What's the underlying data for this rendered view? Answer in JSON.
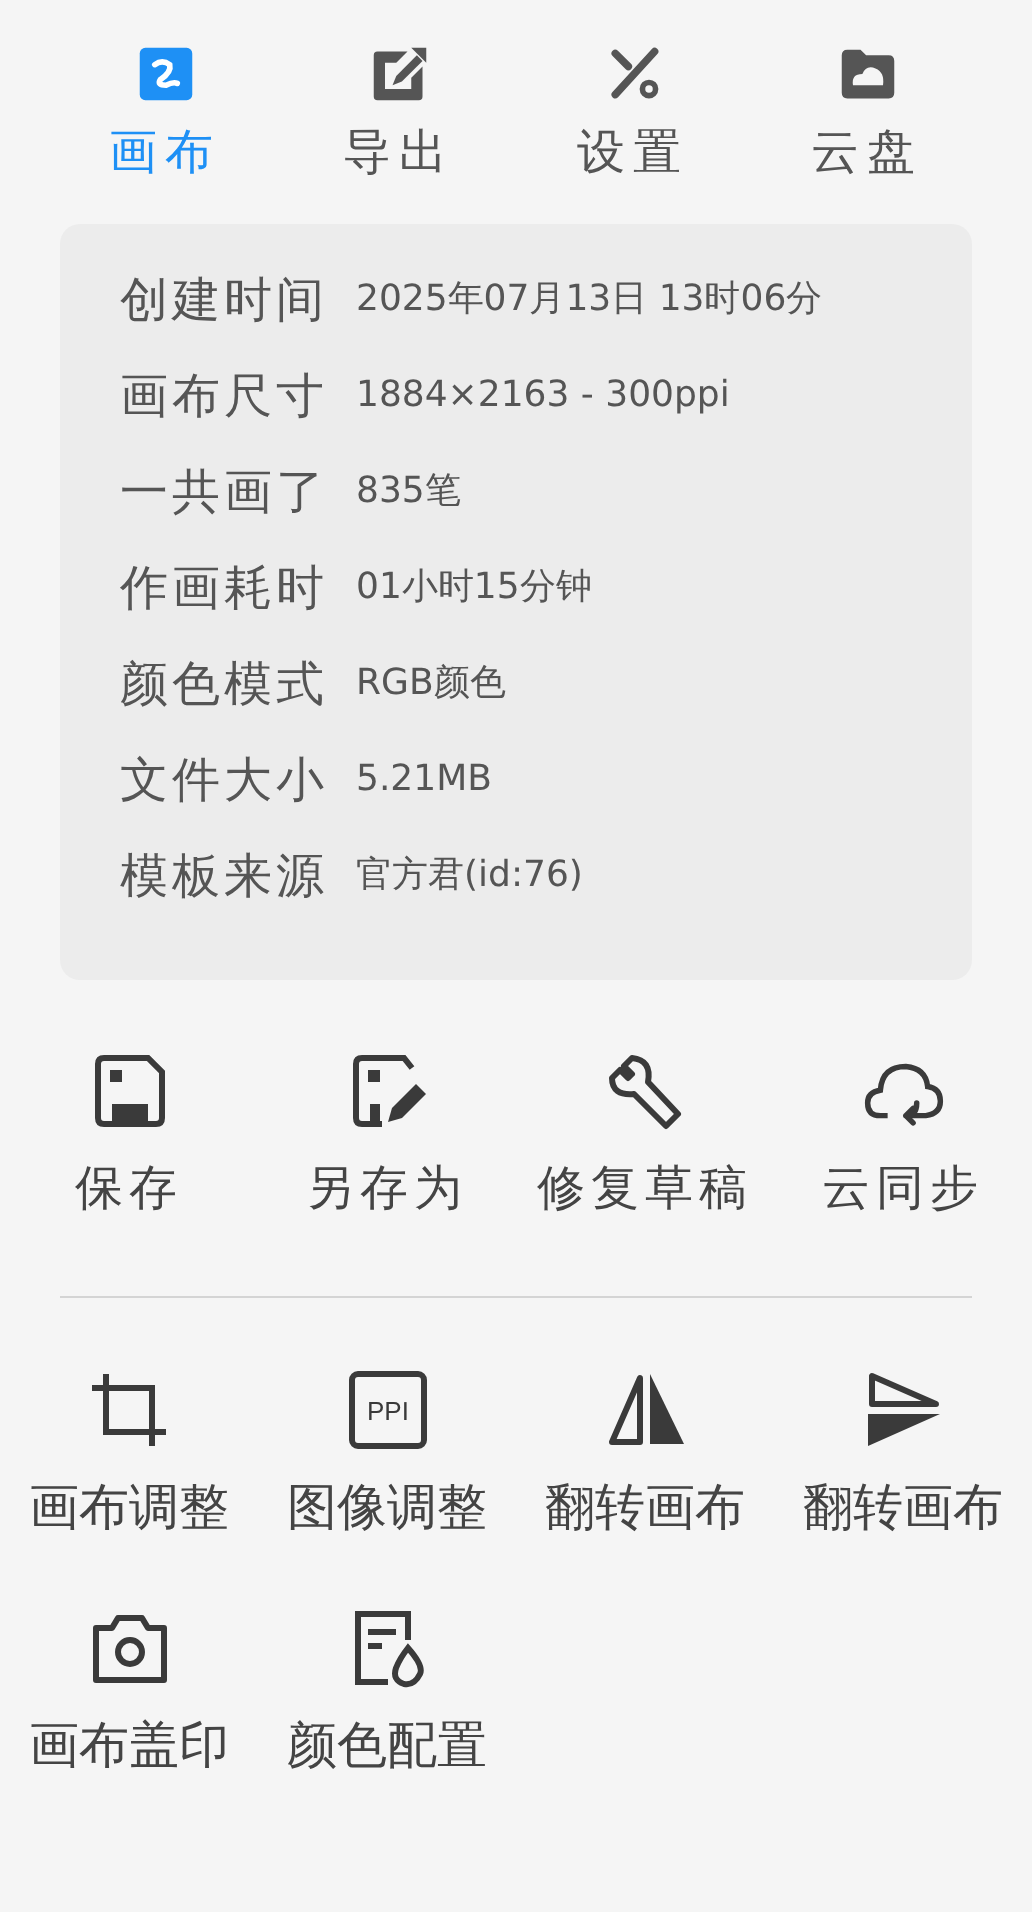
{
  "tabs": [
    {
      "label": "画布",
      "kind": "canvas",
      "selected": true
    },
    {
      "label": "导出",
      "kind": "export",
      "selected": false
    },
    {
      "label": "设置",
      "kind": "settings",
      "selected": false
    },
    {
      "label": "云盘",
      "kind": "cloud",
      "selected": false
    }
  ],
  "info": [
    {
      "label": "创建时间",
      "value": "2025年07月13日  13时06分"
    },
    {
      "label": "画布尺寸",
      "value": "1884×2163 - 300ppi"
    },
    {
      "label": "一共画了",
      "value": "835笔"
    },
    {
      "label": "作画耗时",
      "value": "01小时15分钟"
    },
    {
      "label": "颜色模式",
      "value": "RGB颜色"
    },
    {
      "label": "文件大小",
      "value": "5.21MB"
    },
    {
      "label": "模板来源",
      "value": "官方君(id:76)"
    }
  ],
  "actions": [
    {
      "label": "保存",
      "kind": "save"
    },
    {
      "label": "另存为",
      "kind": "save-as"
    },
    {
      "label": "修复草稿",
      "kind": "repair"
    },
    {
      "label": "云同步",
      "kind": "cloud-sync"
    }
  ],
  "tools": [
    {
      "label": "画布调整",
      "kind": "crop"
    },
    {
      "label": "图像调整",
      "kind": "ppi",
      "icon_text": "PPI"
    },
    {
      "label": "翻转画布",
      "kind": "flip-h"
    },
    {
      "label": "翻转画布",
      "kind": "flip-v"
    },
    {
      "label": "画布盖印",
      "kind": "camera"
    },
    {
      "label": "颜色配置",
      "kind": "color-config"
    }
  ]
}
